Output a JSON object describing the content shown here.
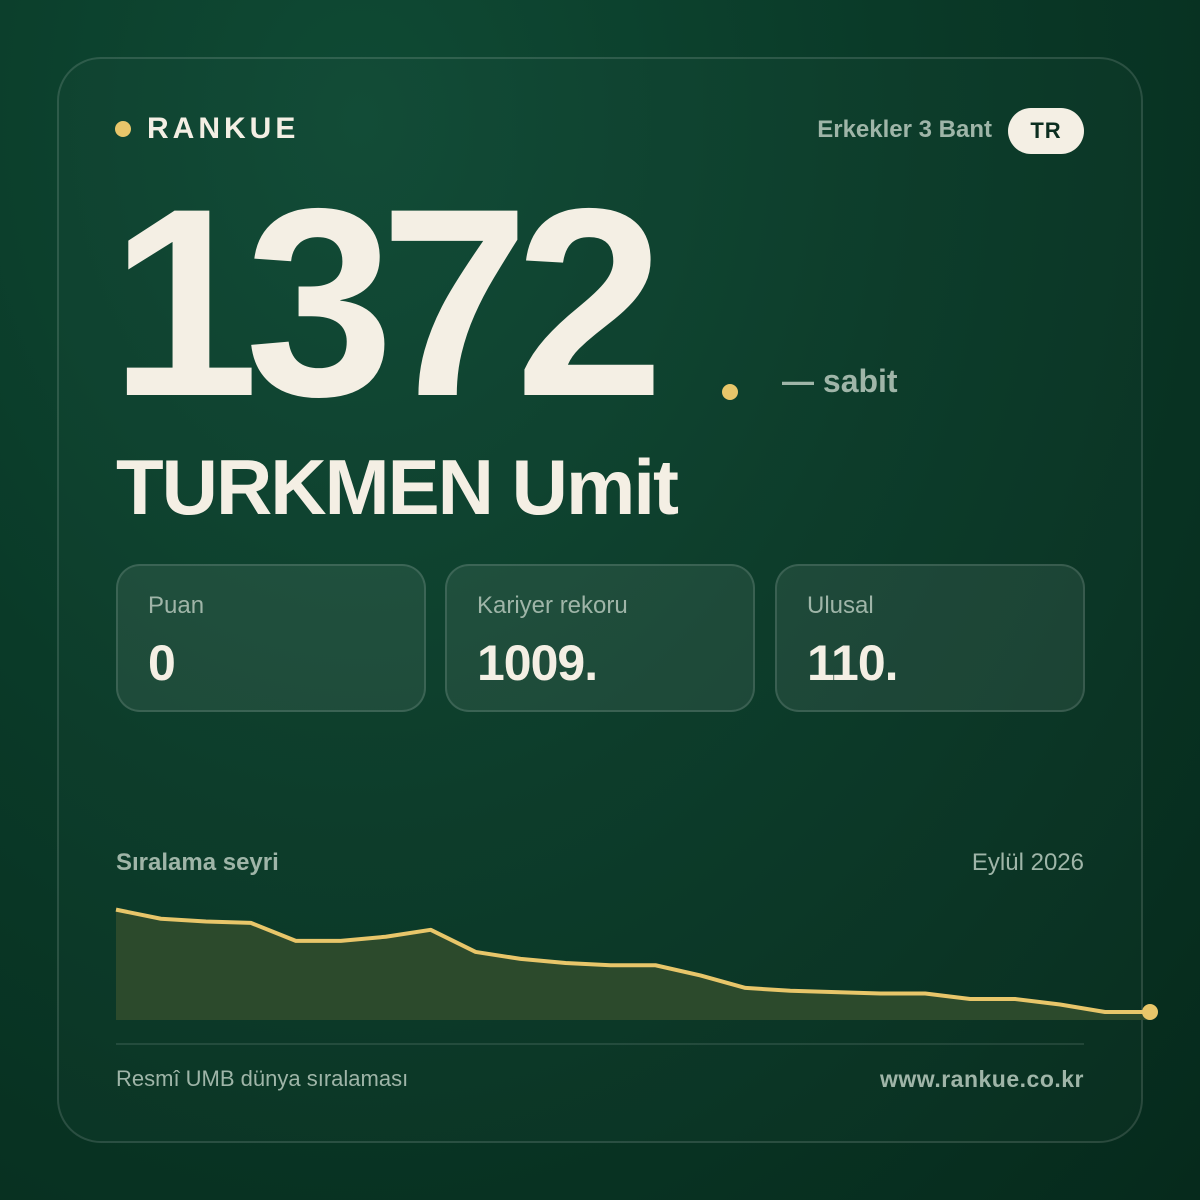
{
  "brand": {
    "name": "RANKUE"
  },
  "header": {
    "category": "Erkekler 3 Bant",
    "country": "TR"
  },
  "rank": {
    "value": "1372",
    "change": "— sabit"
  },
  "player": {
    "name": "TURKMEN Umit"
  },
  "stats": [
    {
      "label": "Puan",
      "value": "0"
    },
    {
      "label": "Kariyer rekoru",
      "value": "1009."
    },
    {
      "label": "Ulusal",
      "value": "110."
    }
  ],
  "chart": {
    "title": "Sıralama seyri",
    "date": "Eylül 2026"
  },
  "footer": {
    "source": "Resmî UMB dünya sıralaması",
    "url": "www.rankue.co.kr"
  },
  "colors": {
    "accent": "#e8c66a",
    "background": "#0a3a28",
    "text": "#f4efe4",
    "muted": "#9fb5a8"
  },
  "chart_data": {
    "type": "area",
    "values": [
      1002,
      1035,
      1045,
      1050,
      1115,
      1115,
      1100,
      1075,
      1155,
      1180,
      1195,
      1203,
      1203,
      1240,
      1285,
      1295,
      1300,
      1305,
      1305,
      1325,
      1325,
      1345,
      1372,
      1372
    ],
    "ylim": [
      960,
      1372
    ],
    "inverted": true,
    "grid": false
  }
}
